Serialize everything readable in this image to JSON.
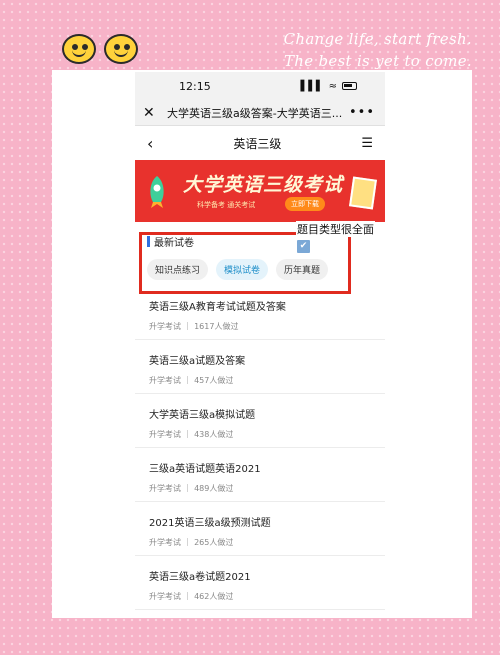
{
  "decor": {
    "slogan_line1": "Change life, start fresh.",
    "slogan_line2": "The best is yet to come.",
    "annotation": "题目类型很全面"
  },
  "status": {
    "time": "12:15",
    "signal": "▌▌▌",
    "wifi": "≈"
  },
  "browser": {
    "close": "✕",
    "title": "大学英语三级a级答案-大学英语三...",
    "more": "•••"
  },
  "nav": {
    "back": "‹",
    "title": "英语三级",
    "menu": "☰"
  },
  "banner": {
    "main": "大学英语三级考试",
    "sub": "科学备考 通关考试",
    "button": "立即下载"
  },
  "section": {
    "title": "最新试卷",
    "icon": "✔"
  },
  "tabs": [
    {
      "label": "知识点练习"
    },
    {
      "label": "模拟试卷"
    },
    {
      "label": "历年真题"
    }
  ],
  "items": [
    {
      "title": "英语三级A教育考试试题及答案",
      "meta": "升学考试 ｜ 1617人做过"
    },
    {
      "title": "英语三级a试题及答案",
      "meta": "升学考试 ｜ 457人做过"
    },
    {
      "title": "大学英语三级a模拟试题",
      "meta": "升学考试 ｜ 438人做过"
    },
    {
      "title": "三级a英语试题英语2021",
      "meta": "升学考试 ｜ 489人做过"
    },
    {
      "title": "2021英语三级a级预测试题",
      "meta": "升学考试 ｜ 265人做过"
    },
    {
      "title": "英语三级a卷试题2021",
      "meta": "升学考试 ｜ 462人做过"
    }
  ],
  "colors": {
    "accent": "#e02b1f",
    "tab_active": "#1f8fc9",
    "banner": "#e8322d"
  }
}
